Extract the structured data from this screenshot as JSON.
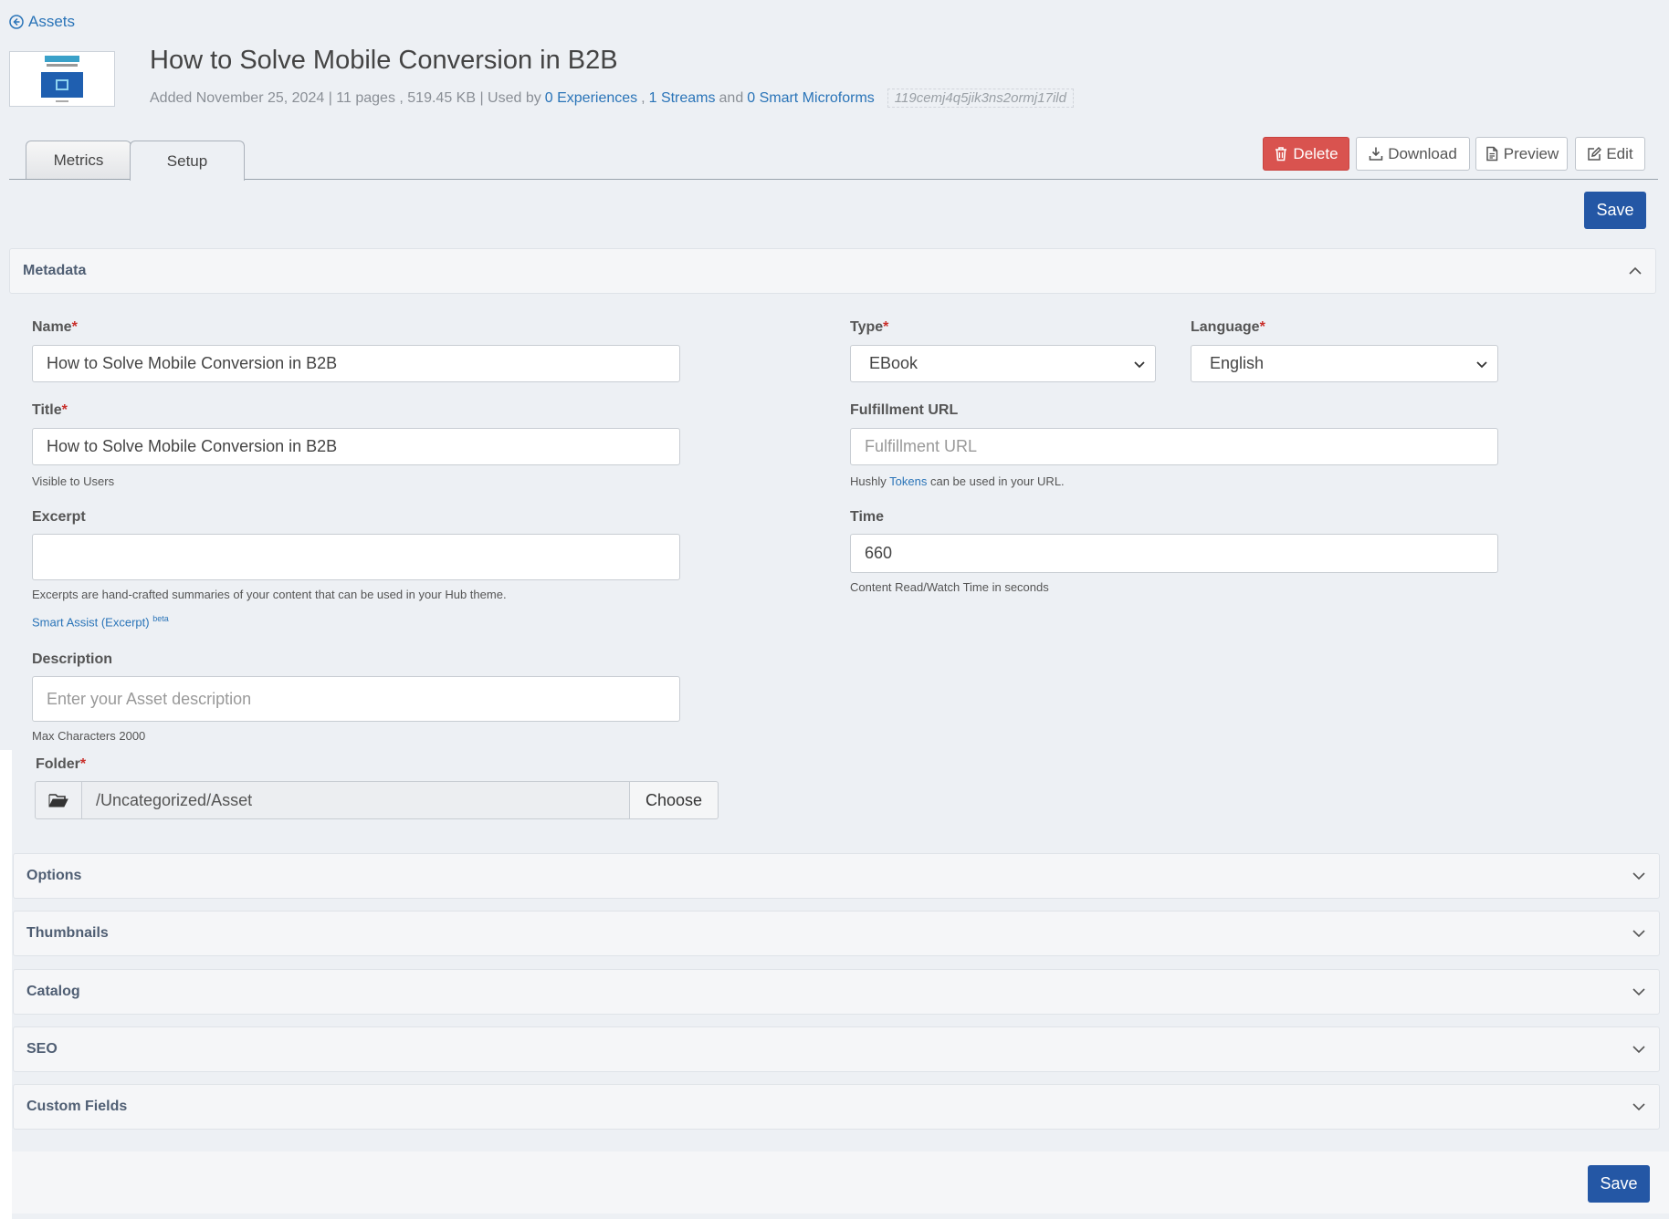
{
  "nav": {
    "back_label": "Assets"
  },
  "asset": {
    "title": "How to Solve Mobile Conversion in B2B",
    "meta_prefix": "Added November 25, 2024 | 11 pages , 519.45 KB | Used by",
    "experiences": "0 Experiences",
    "sep1": ",",
    "streams": "1 Streams",
    "sep2": "and",
    "microforms": "0 Smart Microforms",
    "hash": "119cemj4q5jik3ns2ormj17ild"
  },
  "tabs": [
    {
      "label": "Metrics"
    },
    {
      "label": "Setup"
    }
  ],
  "toolbar": {
    "delete_label": "Delete",
    "download_label": "Download",
    "preview_label": "Preview",
    "edit_label": "Edit",
    "save_label": "Save"
  },
  "panels": {
    "metadata": "Metadata",
    "options": "Options",
    "thumbnails": "Thumbnails",
    "catalog": "Catalog",
    "seo": "SEO",
    "custom_fields": "Custom Fields"
  },
  "form": {
    "name": {
      "label": "Name",
      "req": "*",
      "value": "How to Solve Mobile Conversion in B2B"
    },
    "title": {
      "label": "Title",
      "req": "*",
      "value": "How to Solve Mobile Conversion in B2B",
      "help": "Visible to Users"
    },
    "excerpt": {
      "label": "Excerpt",
      "value": "",
      "help": "Excerpts are hand-crafted summaries of your content that can be used in your Hub theme.",
      "assist": "Smart Assist (Excerpt)",
      "assist_badge": "beta"
    },
    "description": {
      "label": "Description",
      "placeholder": "Enter your Asset description",
      "help": "Max Characters 2000"
    },
    "folder": {
      "label": "Folder",
      "req": "*",
      "value": "/Uncategorized/Asset",
      "choose_label": "Choose"
    },
    "type": {
      "label": "Type",
      "req": "*",
      "value": "EBook"
    },
    "language": {
      "label": "Language",
      "req": "*",
      "value": "English"
    },
    "fulfillment": {
      "label": "Fulfillment URL",
      "placeholder": "Fulfillment URL",
      "help_prefix": "Hushly",
      "help_link": "Tokens",
      "help_suffix": "can be used in your URL."
    },
    "time": {
      "label": "Time",
      "value": "660",
      "help": "Content Read/Watch Time in seconds"
    }
  },
  "icons": {
    "back": "arrow-circle-left-icon",
    "delete": "trash-icon",
    "download": "download-icon",
    "preview": "file-icon",
    "edit": "edit-icon",
    "chevron_up": "chevron-up-icon",
    "chevron_down": "chevron-down-icon",
    "folder": "folder-open-icon"
  },
  "colors": {
    "primary": "#2457a5",
    "danger": "#d9534f",
    "link": "#2a74b8",
    "background": "#edf0f4"
  }
}
